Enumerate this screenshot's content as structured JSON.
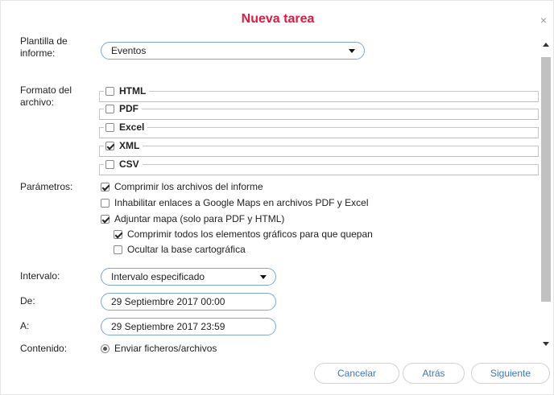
{
  "dialog": {
    "title": "Nueva tarea",
    "close_glyph": "×"
  },
  "labels": {
    "template_line1": "Plantilla de",
    "template_line2": "informe:",
    "format_line1": "Formato del",
    "format_line2": "archivo:",
    "params": "Parámetros:",
    "interval": "Intervalo:",
    "from": "De:",
    "to": "A:",
    "content": "Contenido:"
  },
  "template_select": {
    "value": "Eventos"
  },
  "formats": [
    {
      "label": "HTML",
      "checked": false
    },
    {
      "label": "PDF",
      "checked": false
    },
    {
      "label": "Excel",
      "checked": false
    },
    {
      "label": "XML",
      "checked": true
    },
    {
      "label": "CSV",
      "checked": false
    }
  ],
  "params": [
    {
      "label": "Comprimir los archivos del informe",
      "checked": true
    },
    {
      "label": "Inhabilitar enlaces a Google Maps en archivos PDF y Excel",
      "checked": false
    },
    {
      "label": "Adjuntar mapa (solo para PDF y HTML)",
      "checked": true
    },
    {
      "label": "Comprimir todos los elementos gráficos para que quepan",
      "checked": true
    },
    {
      "label": "Ocultar la base cartográfica",
      "checked": false
    }
  ],
  "interval_select": {
    "value": "Intervalo especificado"
  },
  "from_value": "29 Septiembre 2017 00:00",
  "to_value": "29 Septiembre 2017 23:59",
  "content_option": {
    "label": "Enviar ficheros/archivos",
    "selected": true
  },
  "buttons": {
    "cancel": "Cancelar",
    "back": "Atrás",
    "next": "Siguiente"
  },
  "colors": {
    "title": "#e4173f",
    "accent_border": "#7ea6d6",
    "button_text": "#3a77c2"
  }
}
